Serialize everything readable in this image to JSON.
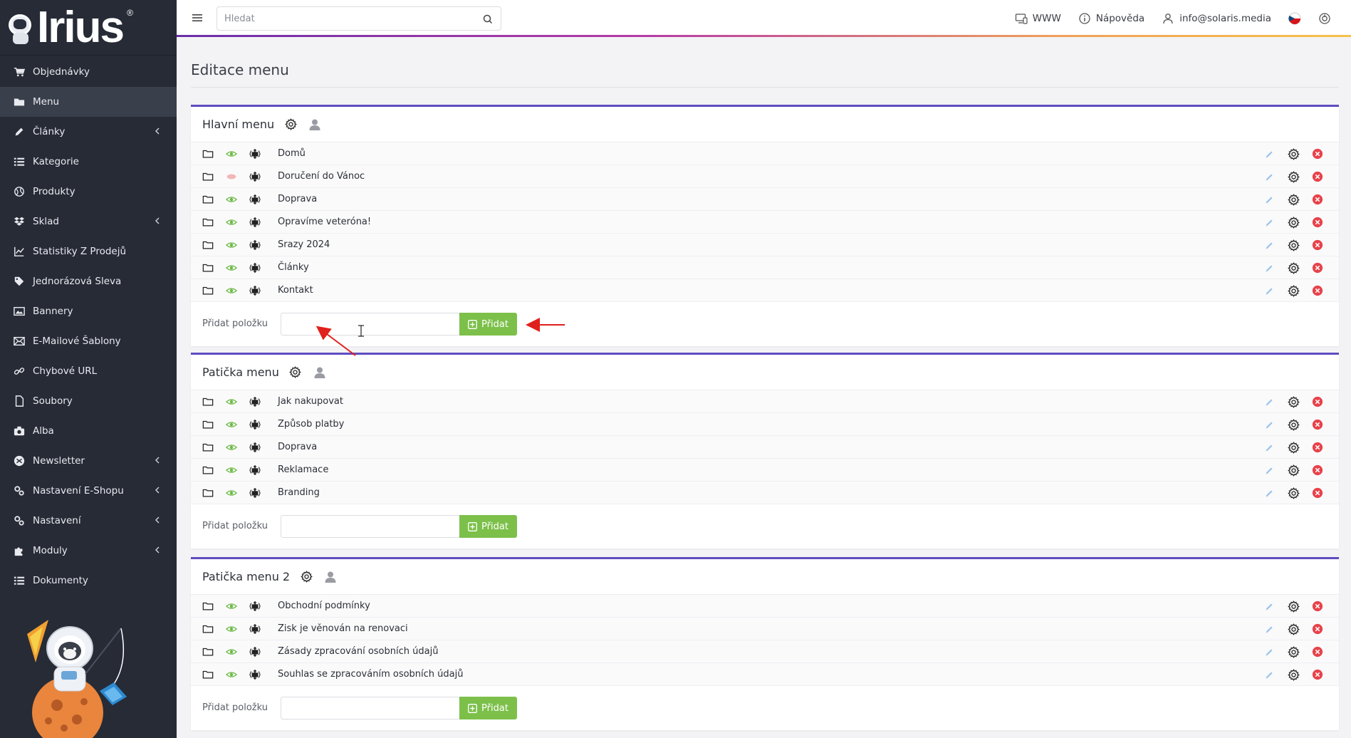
{
  "brand": {
    "name": "Irius",
    "mark": "®"
  },
  "sidebar": {
    "items": [
      {
        "label": "Objednávky",
        "icon": "cart-icon",
        "active": false,
        "has_children": false
      },
      {
        "label": "Menu",
        "icon": "folder-icon",
        "active": true,
        "has_children": false
      },
      {
        "label": "Články",
        "icon": "pencil-icon",
        "active": false,
        "has_children": true
      },
      {
        "label": "Kategorie",
        "icon": "list-icon",
        "active": false,
        "has_children": false
      },
      {
        "label": "Produkty",
        "icon": "globe-icon",
        "active": false,
        "has_children": false
      },
      {
        "label": "Sklad",
        "icon": "dropbox-icon",
        "active": false,
        "has_children": true
      },
      {
        "label": "Statistiky Z Prodejů",
        "icon": "chart-icon",
        "active": false,
        "has_children": false
      },
      {
        "label": "Jednorázová Sleva",
        "icon": "tag-icon",
        "active": false,
        "has_children": false
      },
      {
        "label": "Bannery",
        "icon": "image-icon",
        "active": false,
        "has_children": false
      },
      {
        "label": "E-Mailové Šablony",
        "icon": "envelope-icon",
        "active": false,
        "has_children": false
      },
      {
        "label": "Chybové URL",
        "icon": "link-icon",
        "active": false,
        "has_children": false
      },
      {
        "label": "Soubory",
        "icon": "file-icon",
        "active": false,
        "has_children": false
      },
      {
        "label": "Alba",
        "icon": "camera-icon",
        "active": false,
        "has_children": false
      },
      {
        "label": "Newsletter",
        "icon": "newsletter-icon",
        "active": false,
        "has_children": true
      },
      {
        "label": "Nastavení E-Shopu",
        "icon": "cogs-icon",
        "active": false,
        "has_children": true
      },
      {
        "label": "Nastavení",
        "icon": "cogs-icon",
        "active": false,
        "has_children": true
      },
      {
        "label": "Moduly",
        "icon": "puzzle-icon",
        "active": false,
        "has_children": true
      },
      {
        "label": "Dokumenty",
        "icon": "list-icon",
        "active": false,
        "has_children": false
      }
    ]
  },
  "topbar": {
    "search_placeholder": "Hledat",
    "www_label": "WWW",
    "help_label": "Nápověda",
    "user_label": "info@solaris.media"
  },
  "page": {
    "title": "Editace menu"
  },
  "menus": [
    {
      "title": "Hlavní menu",
      "add_label": "Přidat položku",
      "add_button": "Přidat",
      "items": [
        {
          "label": "Domů",
          "visible": true
        },
        {
          "label": "Doručení do Vánoc",
          "visible": false
        },
        {
          "label": "Doprava",
          "visible": true
        },
        {
          "label": "Opravíme veteróna!",
          "visible": true
        },
        {
          "label": "Srazy 2024",
          "visible": true
        },
        {
          "label": "Články",
          "visible": true
        },
        {
          "label": "Kontakt",
          "visible": true
        }
      ]
    },
    {
      "title": "Patička menu",
      "add_label": "Přidat položku",
      "add_button": "Přidat",
      "items": [
        {
          "label": "Jak nakupovat",
          "visible": true
        },
        {
          "label": "Způsob platby",
          "visible": true
        },
        {
          "label": "Doprava",
          "visible": true
        },
        {
          "label": "Reklamace",
          "visible": true
        },
        {
          "label": "Branding",
          "visible": true
        }
      ]
    },
    {
      "title": "Patička menu 2",
      "add_label": "Přidat položku",
      "add_button": "Přidat",
      "items": [
        {
          "label": "Obchodní podmínky",
          "visible": true
        },
        {
          "label": "Zisk je věnován na renovaci",
          "visible": true
        },
        {
          "label": "Zásady zpracování osobních údajů",
          "visible": true
        },
        {
          "label": "Souhlas se zpracováním osobních údajů",
          "visible": true
        }
      ]
    }
  ],
  "colors": {
    "sidebar_bg": "#262b36",
    "panel_accent": "#5e4dc1",
    "add_button": "#7cc04a",
    "eye_visible": "#6dbb45",
    "eye_hidden": "#f4b6b6",
    "delete": "#e8424a",
    "annotation": "#e0201c"
  }
}
